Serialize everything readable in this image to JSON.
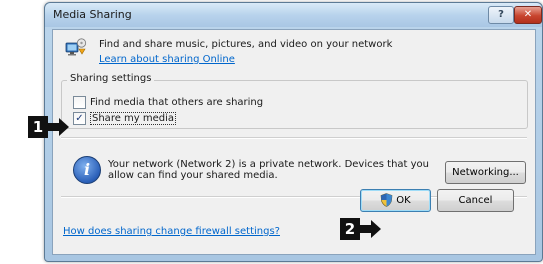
{
  "window": {
    "title": "Media Sharing",
    "help_button": "?",
    "close_button": "✕"
  },
  "header": {
    "description": "Find and share music, pictures, and video on your network",
    "learn_link": "Learn about sharing Online"
  },
  "sharing_settings": {
    "legend": "Sharing settings",
    "options": [
      {
        "label": "Find media that others are sharing",
        "checked": false
      },
      {
        "label": "Share my media",
        "checked": true
      }
    ]
  },
  "network": {
    "info_text": "Your network (Network  2) is a private network. Devices that you allow can find your shared media.",
    "networking_button": "Networking..."
  },
  "footer": {
    "firewall_link": "How does sharing change firewall settings?",
    "ok_button": "OK",
    "cancel_button": "Cancel"
  },
  "callouts": {
    "first": "1",
    "second": "2"
  },
  "icons": {
    "media": "media-sharing-icon",
    "info": "info-icon",
    "shield": "uac-shield-icon",
    "arrow": "arrow-right-icon"
  },
  "colors": {
    "link": "#0066cc",
    "title_bar": "#b8d3ec",
    "client_bg": "#f0f0f0",
    "close": "#c8452f",
    "callout": "#111111"
  }
}
